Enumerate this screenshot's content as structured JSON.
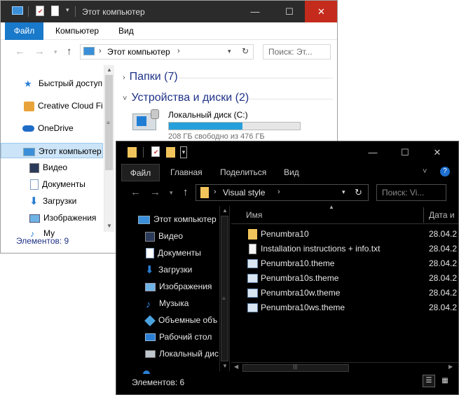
{
  "back_window": {
    "title": "Этот компьютер",
    "caption": {
      "minimize": "—",
      "maximize": "☐",
      "close": "✕"
    },
    "ribbon_tabs": [
      "Файл",
      "Компьютер",
      "Вид"
    ],
    "address_path": "Этот компьютер",
    "search_placeholder": "Поиск: Эт...",
    "sidebar": [
      {
        "label": "Быстрый доступ",
        "icon": "star-icon"
      },
      {
        "label": "Creative Cloud Fil",
        "icon": "creative-cloud-icon"
      },
      {
        "label": "OneDrive",
        "icon": "onedrive-cloud-icon"
      },
      {
        "label": "Этот компьютер",
        "icon": "computer-icon",
        "selected": true
      },
      {
        "label": "Видео",
        "icon": "video-icon"
      },
      {
        "label": "Документы",
        "icon": "documents-icon"
      },
      {
        "label": "Загрузки",
        "icon": "downloads-icon"
      },
      {
        "label": "Изображения",
        "icon": "pictures-icon"
      },
      {
        "label": "Му",
        "icon": "music-icon"
      }
    ],
    "groups": [
      {
        "label": "Папки (7)",
        "expanded": false
      },
      {
        "label": "Устройства и диски (2)",
        "expanded": true
      }
    ],
    "drive": {
      "name": "Локальный диск (C:)",
      "free_text": "208 ГБ свободно из 476 ГБ",
      "used_fraction": 0.56
    },
    "status": "Элементов: 9"
  },
  "front_window": {
    "ribbon_tabs": [
      "Файл",
      "Главная",
      "Поделиться",
      "Вид"
    ],
    "address_path": "Visual style",
    "search_placeholder": "Поиск: Vi...",
    "sidebar": [
      {
        "label": "Этот компьютер",
        "icon": "computer-icon"
      },
      {
        "label": "Видео",
        "icon": "video-icon"
      },
      {
        "label": "Документы",
        "icon": "documents-icon"
      },
      {
        "label": "Загрузки",
        "icon": "downloads-icon"
      },
      {
        "label": "Изображения",
        "icon": "pictures-icon"
      },
      {
        "label": "Музыка",
        "icon": "music-icon"
      },
      {
        "label": "Объемные объ",
        "icon": "3d-objects-icon"
      },
      {
        "label": "Рабочий стол",
        "icon": "desktop-icon"
      },
      {
        "label": "Локальный дис",
        "icon": "local-disk-icon"
      }
    ],
    "columns": {
      "name": "Имя",
      "date": "Дата и"
    },
    "files": [
      {
        "name": "Penumbra10",
        "date": "28.04.2",
        "icon": "folder-icon"
      },
      {
        "name": "Installation instructions + info.txt",
        "date": "28.04.2",
        "icon": "text-file-icon"
      },
      {
        "name": "Penumbra10.theme",
        "date": "28.04.2",
        "icon": "theme-file-icon"
      },
      {
        "name": "Penumbra10s.theme",
        "date": "28.04.2",
        "icon": "theme-file-icon"
      },
      {
        "name": "Penumbra10w.theme",
        "date": "28.04.2",
        "icon": "theme-file-icon"
      },
      {
        "name": "Penumbra10ws.theme",
        "date": "28.04.2",
        "icon": "theme-file-icon"
      }
    ],
    "status": "Элементов: 6"
  },
  "colors": {
    "accent": "#1979ca",
    "drive_fill": "#26a0da",
    "dark_bg": "#000000",
    "light_title": "#2b2b2b"
  }
}
